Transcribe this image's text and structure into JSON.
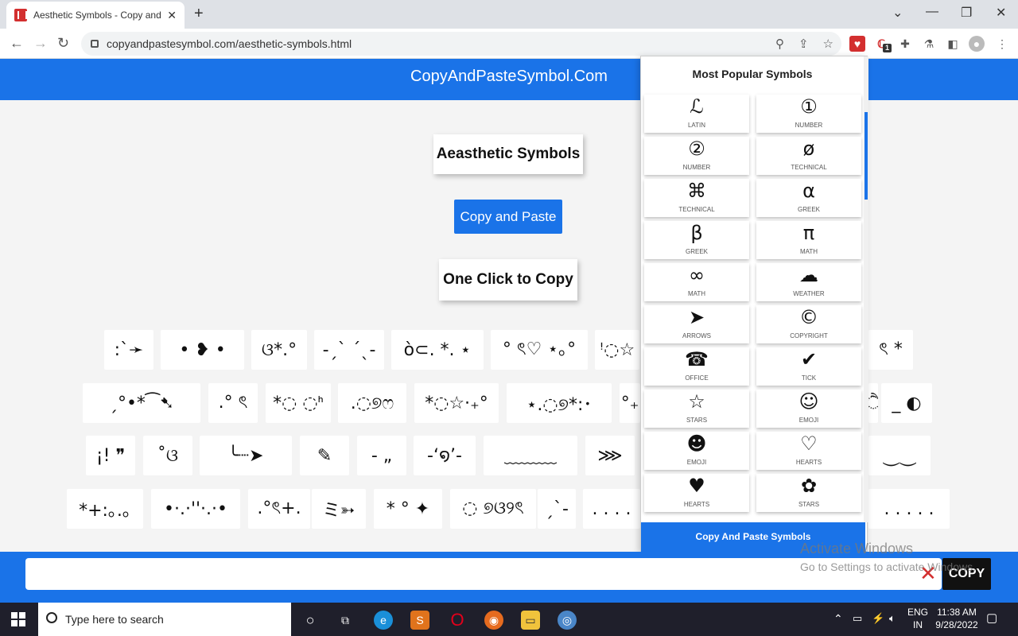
{
  "browser": {
    "tab_title": "Aesthetic Symbols - Copy and Pa",
    "url": "copyandpastesymbol.com/aesthetic-symbols.html",
    "ext_badge": "1"
  },
  "site": {
    "header_title": "CopyAndPasteSymbol.Com",
    "page_heading": "Aeasthetic Symbols",
    "copy_paste_button": "Copy and Paste",
    "one_click_label": "One Click to Copy"
  },
  "symbols": {
    "row1": [
      ":`➛",
      "• ❥ •",
      "ଓ*.°",
      "-ˏˋ ˊˎ-",
      "ò⊂. *. ⋆",
      "° ৎ♡ ⋆｡°",
      "ꜝ◌☆",
      "ৎ *"
    ],
    "row2": [
      "ˏ°•*⁀➷",
      ".° ৎ",
      "*◌ ◌ᑋ",
      ".◌୭ෆ",
      "*◌☆⋅₊°",
      "⋆.◌୭*:･",
      "°₊",
      "ੈ",
      "_ ◐"
    ],
    "row3": [
      "¡! ❞",
      "˚ଓ",
      "╰┈➤",
      "✎",
      "- „",
      "-‘໑’-",
      "﹏﹏﹏",
      "⋙",
      "⏝⏝"
    ],
    "row4": [
      "*+:｡.｡",
      "•·.·''·.·•",
      ".°ৎ+.",
      "ミ➳",
      "* ° ✦",
      "◌ ୭ଓ୨ৎ",
      "ˏˋ-",
      ". . . .",
      ". . . . ."
    ]
  },
  "popup": {
    "title": "Most Popular Symbols",
    "items": [
      {
        "glyph": "ℒ",
        "label": "LATIN"
      },
      {
        "glyph": "①",
        "label": "NUMBER"
      },
      {
        "glyph": "②",
        "label": "NUMBER"
      },
      {
        "glyph": "ø",
        "label": "TECHNICAL"
      },
      {
        "glyph": "⌘",
        "label": "TECHNICAL"
      },
      {
        "glyph": "α",
        "label": "GREEK"
      },
      {
        "glyph": "β",
        "label": "GREEK"
      },
      {
        "glyph": "π",
        "label": "MATH"
      },
      {
        "glyph": "∞",
        "label": "MATH"
      },
      {
        "glyph": "☁",
        "label": "WEATHER"
      },
      {
        "glyph": "➤",
        "label": "ARROWS"
      },
      {
        "glyph": "©",
        "label": "COPYRIGHT"
      },
      {
        "glyph": "☎",
        "label": "OFFICE"
      },
      {
        "glyph": "✔",
        "label": "TICK"
      },
      {
        "glyph": "☆",
        "label": "STARS"
      },
      {
        "glyph": "☺",
        "label": "EMOJI"
      },
      {
        "glyph": "☻",
        "label": "EMOJI"
      },
      {
        "glyph": "♡",
        "label": "HEARTS"
      },
      {
        "glyph": "♥",
        "label": "HEARTS"
      },
      {
        "glyph": "✿",
        "label": "STARS"
      }
    ],
    "footer": "Copy And Paste Symbols"
  },
  "copybar": {
    "copy_button": "COPY",
    "clear_icon": "✕"
  },
  "watermark": {
    "line1": "Activate Windows",
    "line2": "Go to Settings to activate Windows."
  },
  "taskbar": {
    "search_placeholder": "Type here to search",
    "lang_line1": "ENG",
    "lang_line2": "IN",
    "time": "11:38 AM",
    "date": "9/28/2022"
  },
  "colors": {
    "brand_blue": "#1a73e8",
    "taskbar": "#1f1f2b"
  }
}
